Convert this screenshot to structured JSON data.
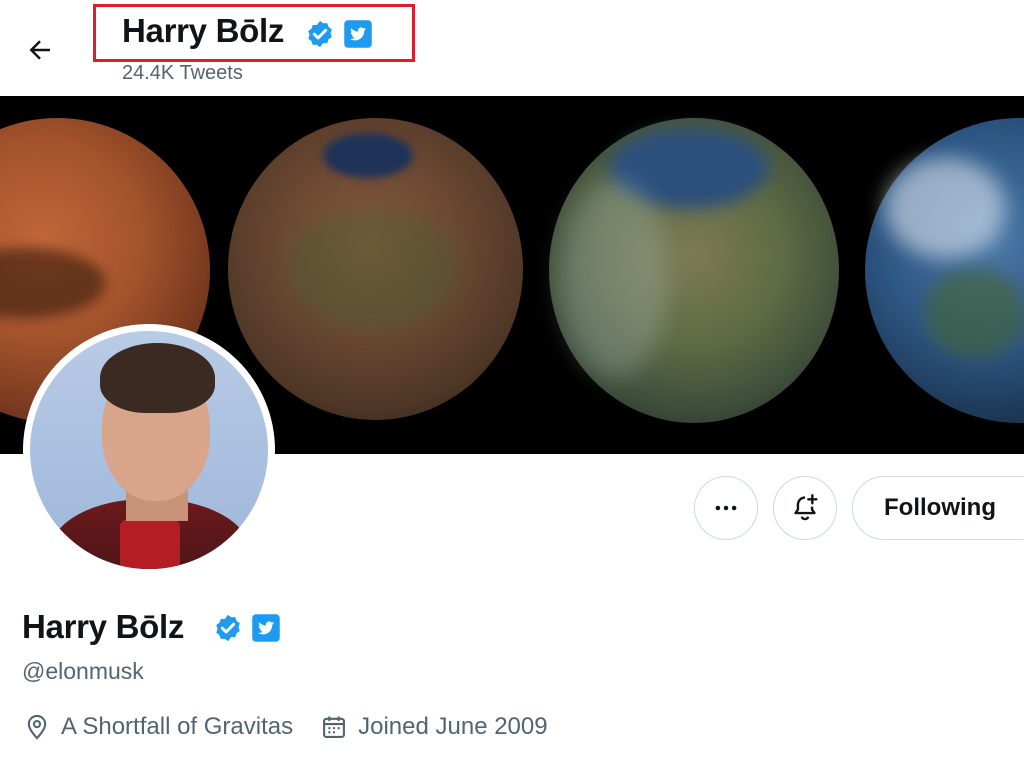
{
  "header": {
    "name": "Harry Bōlz",
    "tweet_count": "24.4K Tweets",
    "back_icon": "arrow-left-icon"
  },
  "badges": {
    "verified_icon": "verified-badge-icon",
    "twitter_icon": "twitter-bird-icon",
    "verified_color": "#1d9bf0",
    "twitter_color": "#1d9bf0"
  },
  "annotation": {
    "highlight_color": "#e01e2b"
  },
  "actions": {
    "more_icon": "more-options-icon",
    "bell_icon": "notification-bell-plus-icon",
    "following_label": "Following"
  },
  "profile": {
    "name": "Harry Bōlz",
    "handle": "@elonmusk",
    "location": "A Shortfall of Gravitas",
    "joined": "Joined June 2009",
    "location_icon": "location-pin-icon",
    "calendar_icon": "calendar-icon"
  }
}
